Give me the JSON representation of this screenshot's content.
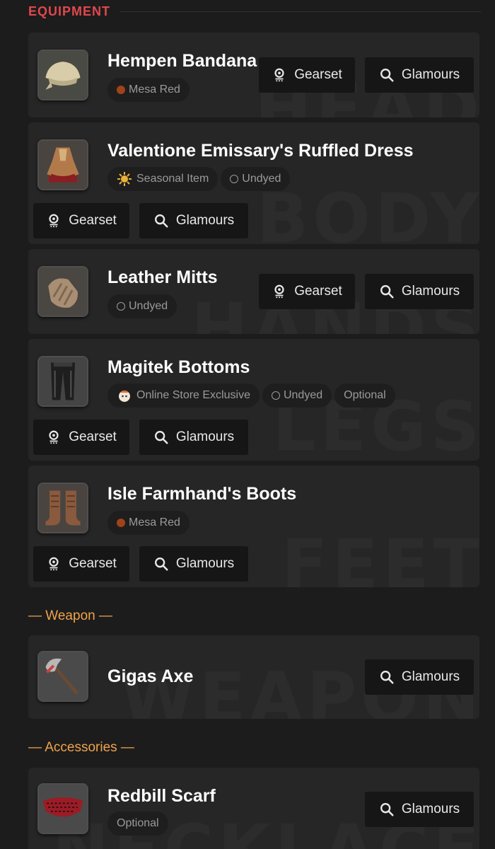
{
  "section": {
    "title": "EQUIPMENT"
  },
  "buttons": {
    "gearset": "Gearset",
    "glamours": "Glamours"
  },
  "items": [
    {
      "name": "Hempen Bandana",
      "slot_word": "HEAD",
      "tags": [
        {
          "label": "Mesa Red",
          "kind": "dye",
          "color": "#a0431a"
        }
      ]
    },
    {
      "name": "Valentione Emissary's Ruffled Dress",
      "slot_word": "BODY",
      "tags": [
        {
          "label": "Seasonal Item",
          "kind": "seasonal"
        },
        {
          "label": "Undyed",
          "kind": "undyed"
        }
      ]
    },
    {
      "name": "Leather Mitts",
      "slot_word": "HANDS",
      "tags": [
        {
          "label": "Undyed",
          "kind": "undyed"
        }
      ]
    },
    {
      "name": "Magitek Bottoms",
      "slot_word": "LEGS",
      "tags": [
        {
          "label": "Online Store Exclusive",
          "kind": "store"
        },
        {
          "label": "Undyed",
          "kind": "undyed"
        },
        {
          "label": "Optional",
          "kind": "plain"
        }
      ]
    },
    {
      "name": "Isle Farmhand's Boots",
      "slot_word": "FEET",
      "tags": [
        {
          "label": "Mesa Red",
          "kind": "dye",
          "color": "#a0431a"
        }
      ]
    }
  ],
  "weapon": {
    "header": "— Weapon —",
    "name": "Gigas Axe",
    "slot_word": "WEAPON"
  },
  "accessories": {
    "header": "— Accessories —",
    "name": "Redbill Scarf",
    "slot_word": "NECKLACE",
    "tag": "Optional"
  },
  "colors": {
    "accent_red": "#e0474c",
    "accent_orange": "#f0a34a",
    "mesa_red": "#a0431a"
  }
}
